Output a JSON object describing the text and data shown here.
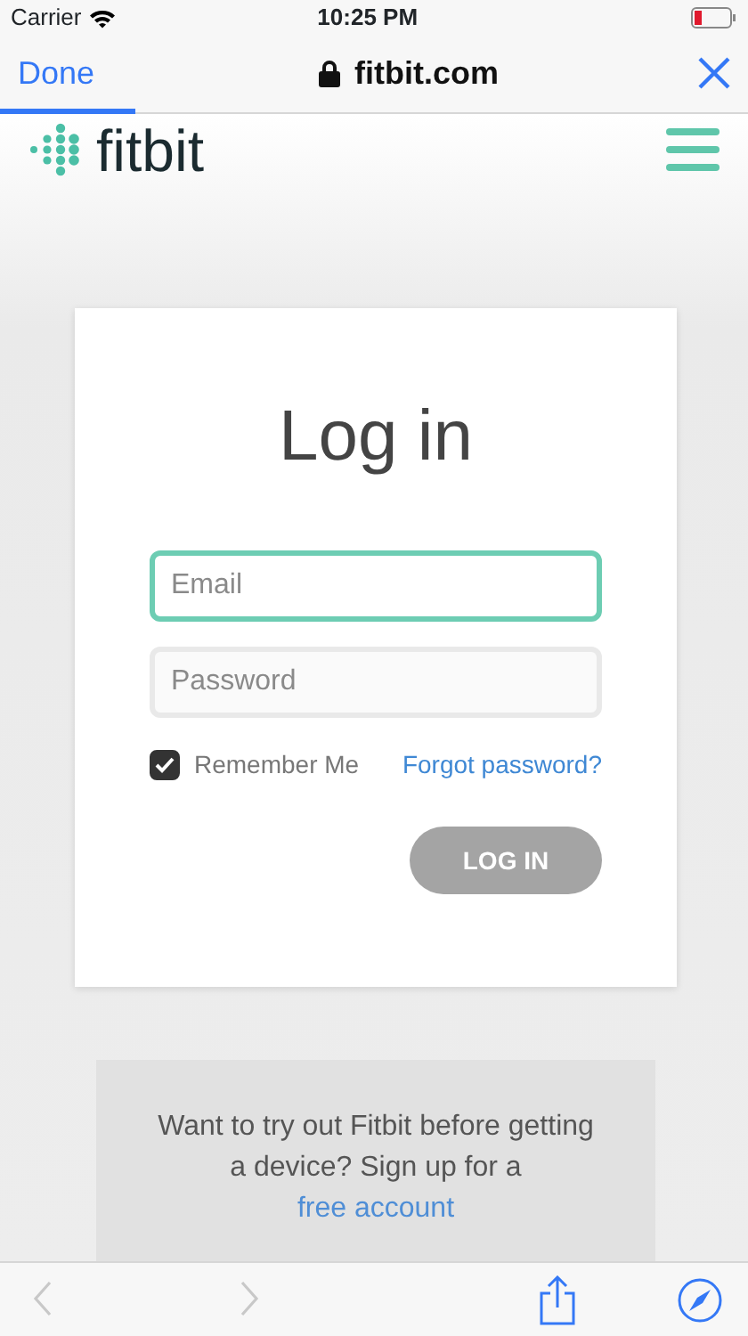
{
  "status_bar": {
    "carrier": "Carrier",
    "time": "10:25 PM"
  },
  "browser_bar": {
    "done": "Done",
    "url": "fitbit.com",
    "loading": {
      "level": 0.18
    }
  },
  "site_header": {
    "logo": "fitbit"
  },
  "login_card": {
    "title": "Log in",
    "fields": [
      {
        "placeholder": "Email",
        "focused": true
      },
      {
        "placeholder": "Password",
        "focused": false
      }
    ],
    "remember": {
      "label": "Remember Me",
      "checked": true
    },
    "forgot_link": "Forgot password?",
    "submit": {
      "label": "LOG IN",
      "disabled": true
    }
  },
  "promo": {
    "text": "Want to try out Fitbit before getting a device? Sign up for a",
    "link": "free account"
  },
  "toolbar": {
    "back_disabled": true,
    "forward_disabled": true
  }
}
